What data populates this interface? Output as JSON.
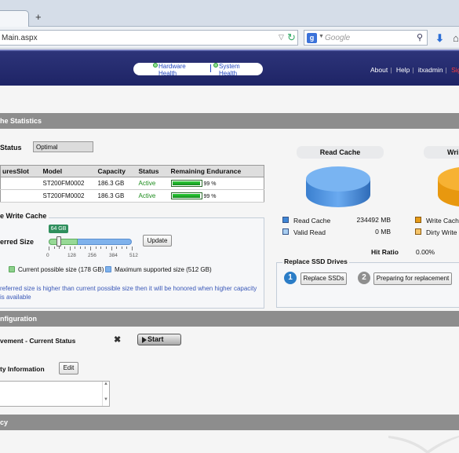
{
  "browser": {
    "new_tab_glyph": "+",
    "url": "Main.aspx",
    "search_placeholder": "Google",
    "search_engine_letter": "g"
  },
  "header": {
    "nav_pills": [
      {
        "label": "Hardware Health"
      },
      {
        "label": "System Health"
      }
    ],
    "links": {
      "about": "About",
      "help": "Help",
      "user": "itxadmin",
      "signout": "Sign Out"
    }
  },
  "sections": {
    "statistics": "he Statistics",
    "configuration": "nfiguration",
    "bottom": "cy"
  },
  "status": {
    "label": "Status",
    "value": "Optimal"
  },
  "ssd_table": {
    "headers": [
      "uresSlot",
      "Model",
      "Capacity",
      "Status",
      "Remaining Endurance"
    ],
    "rows": [
      {
        "slot": "",
        "model": "ST200FM0002",
        "capacity": "186.3 GB",
        "status": "Active",
        "endurance_pct": 99,
        "endurance_label": "99 %"
      },
      {
        "slot": "",
        "model": "ST200FM0002",
        "capacity": "186.3 GB",
        "status": "Active",
        "endurance_pct": 99,
        "endurance_label": "99 %"
      }
    ]
  },
  "write_cache": {
    "title": "e Write Cache",
    "preferred_label": "erred Size",
    "slider_value_label": "64 GB",
    "slider_value_gb": 64,
    "current_possible_gb": 178,
    "max_supported_gb": 512,
    "tick_labels": [
      "0",
      "128",
      "256",
      "384",
      "512"
    ],
    "update_label": "Update",
    "legend_current": "Current possible size (178 GB)",
    "legend_max": "Maximum supported size (512 GB)",
    "note": "referred size is higher than current possible size then it will be honored when higher capacity is available"
  },
  "read_cache": {
    "title": "Read Cache",
    "rows": [
      {
        "label": "Read Cache",
        "value": "234492 MB",
        "color": "#3f86d6"
      },
      {
        "label": "Valid Read",
        "value": "0 MB",
        "color": "#a8cdf0"
      }
    ],
    "hit_ratio_label": "Hit Ratio",
    "hit_ratio_value": "0.00%"
  },
  "write_cache_chart": {
    "title": "Wri",
    "rows": [
      {
        "label": "Write Cach",
        "color": "#e59a17"
      },
      {
        "label": "Dirty Write",
        "color": "#f5c469"
      }
    ]
  },
  "replace_ssd": {
    "title": "Replace SSD Drives",
    "step1": "1",
    "step2": "2",
    "replace_label": "Replace SSDs",
    "prepare_label": "Preparing for replacement"
  },
  "config": {
    "improvement_label": "vement - Current Status",
    "close_glyph": "✖",
    "start_label": "Start",
    "security_label": "ty Information",
    "edit_label": "Edit",
    "scroll_up": "▲",
    "scroll_down": "▼"
  },
  "colors": {
    "header_bg": "#1e2466",
    "section_bar": "#8d8d8d",
    "active_green": "#1d8c1d",
    "signout_red": "#ff3a3a"
  }
}
